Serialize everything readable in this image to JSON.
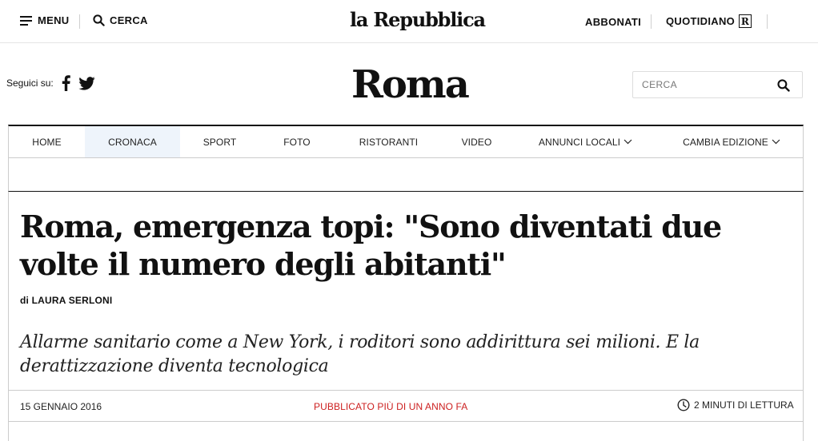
{
  "topbar": {
    "menu_label": "MENU",
    "search_label": "CERCA",
    "logo_text": "la Repubblica",
    "subscribe_label": "ABBONATI",
    "daily_label": "QUOTIDIANO",
    "daily_badge": "R"
  },
  "section_header": {
    "follow_label": "Seguici su:",
    "social_icons": [
      "facebook-icon",
      "twitter-icon"
    ],
    "title": "Roma",
    "search_placeholder": "CERCA"
  },
  "nav": {
    "active": "CRONACA",
    "items": [
      {
        "label": "HOME"
      },
      {
        "label": "CRONACA"
      },
      {
        "label": "SPORT"
      },
      {
        "label": "FOTO"
      },
      {
        "label": "RISTORANTI"
      },
      {
        "label": "VIDEO"
      },
      {
        "label": "ANNUNCI LOCALI"
      },
      {
        "label": "CAMBIA EDIZIONE"
      }
    ]
  },
  "article": {
    "headline": "Roma, emergenza topi: \"Sono diventati due volte il numero degli abitanti\"",
    "byline_prefix": "di",
    "author": "LAURA SERLONI",
    "summary": "Allarme sanitario come a New York, i roditori sono addirittura sei milioni. E la derattizzazione diventa tecnologica",
    "date": "15 GENNAIO 2016",
    "published_note": "PUBBLICATO PIÙ DI UN ANNO FA",
    "read_time": "2 MINUTI DI LETTURA"
  },
  "colors": {
    "text": "#111111",
    "accent_red": "#cc1f1f",
    "active_tab_bg": "#eef4fb",
    "border": "#cccccc"
  }
}
